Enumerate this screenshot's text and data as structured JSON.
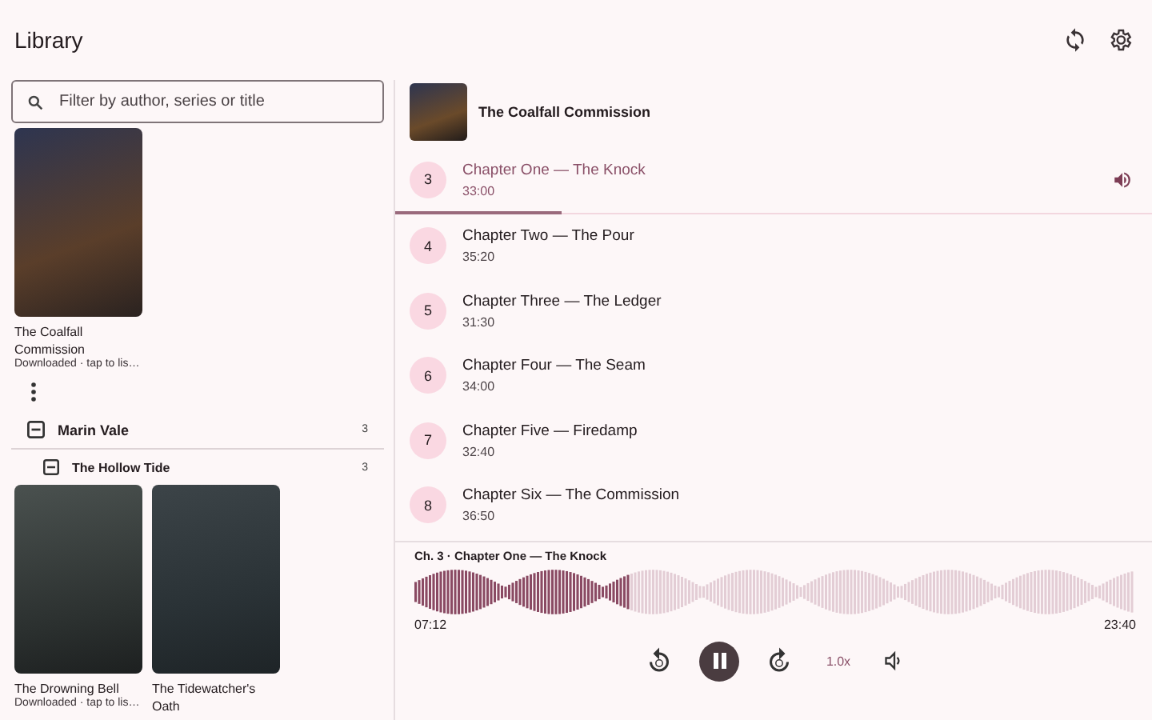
{
  "header": {
    "title": "Library"
  },
  "library": {
    "search": {
      "placeholder": "Filter by author, series or title"
    },
    "books": [
      {
        "title": "The Coalfall Commission",
        "status": "Downloaded · tap to lis…"
      }
    ],
    "groups": [
      {
        "name": "Marin Vale",
        "count": "3",
        "expanded": true,
        "children": [
          {
            "name": "The Hollow Tide",
            "count": "3",
            "expanded": true,
            "books": [
              {
                "title": "The Drowning Bell",
                "status": "Downloaded · tap to lis…"
              },
              {
                "title": "The Tidewatcher's Oath"
              }
            ]
          }
        ]
      }
    ]
  },
  "player": {
    "book_title": "The Coalfall Commission",
    "chapters": [
      {
        "number": "3",
        "title": "Chapter One — The Knock",
        "duration": "33:00",
        "selected": true,
        "level": 0.22
      },
      {
        "number": "4",
        "title": "Chapter Two — The Pour",
        "duration": "35:20",
        "selected": false
      },
      {
        "number": "5",
        "title": "Chapter Three — The Ledger",
        "duration": "31:30",
        "selected": false
      },
      {
        "number": "6",
        "title": "Chapter Four — The Seam",
        "duration": "34:00",
        "selected": false
      },
      {
        "number": "7",
        "title": "Chapter Five — Firedamp",
        "duration": "32:40",
        "selected": false
      },
      {
        "number": "8",
        "title": "Chapter Six — The Commission",
        "duration": "36:50",
        "selected": false
      }
    ],
    "now_playing": "Ch. 3 · Chapter One — The Knock",
    "level": 0.3,
    "elapsed": "07:12",
    "remaining": "23:40",
    "speed": "1.0x",
    "playing": true
  }
}
